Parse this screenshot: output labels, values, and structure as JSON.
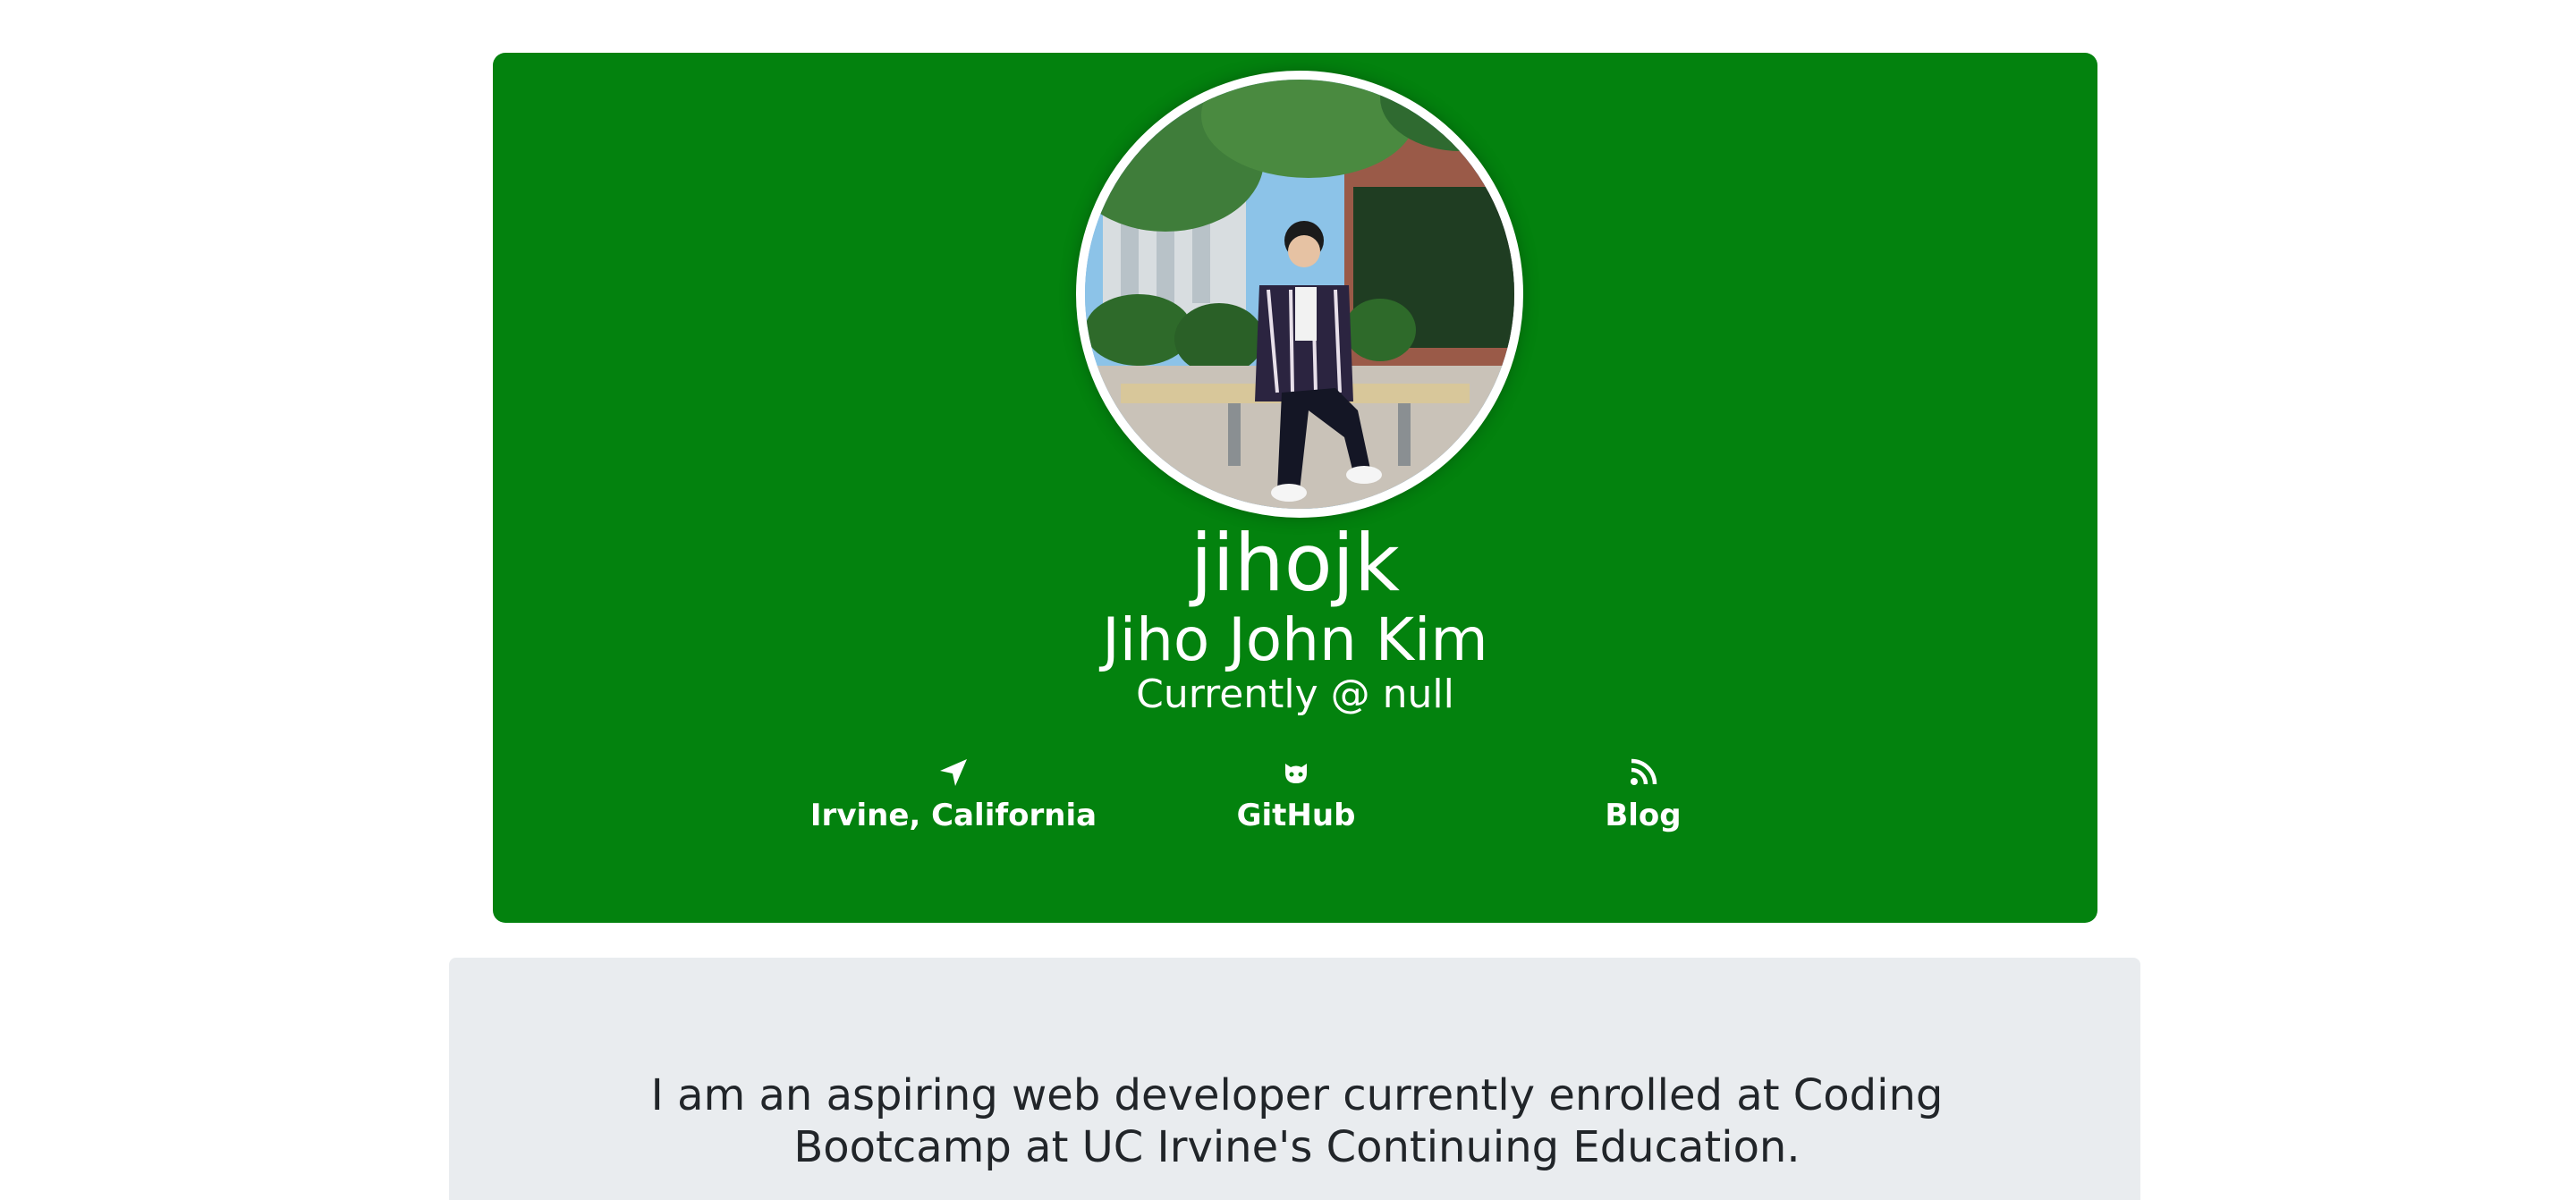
{
  "profile": {
    "username": "jihojk",
    "full_name": "Jiho John Kim",
    "company": "Currently @ null",
    "card_color": "#03820e",
    "avatar_alt": "profile-photo"
  },
  "links": {
    "location": {
      "label": "Irvine, California",
      "icon": "location-arrow-icon"
    },
    "github": {
      "label": "GitHub",
      "icon": "github-icon"
    },
    "blog": {
      "label": "Blog",
      "icon": "rss-icon"
    }
  },
  "bio": {
    "text": "I am an aspiring web developer currently enrolled at Coding Bootcamp at UC Irvine's Continuing Education."
  }
}
